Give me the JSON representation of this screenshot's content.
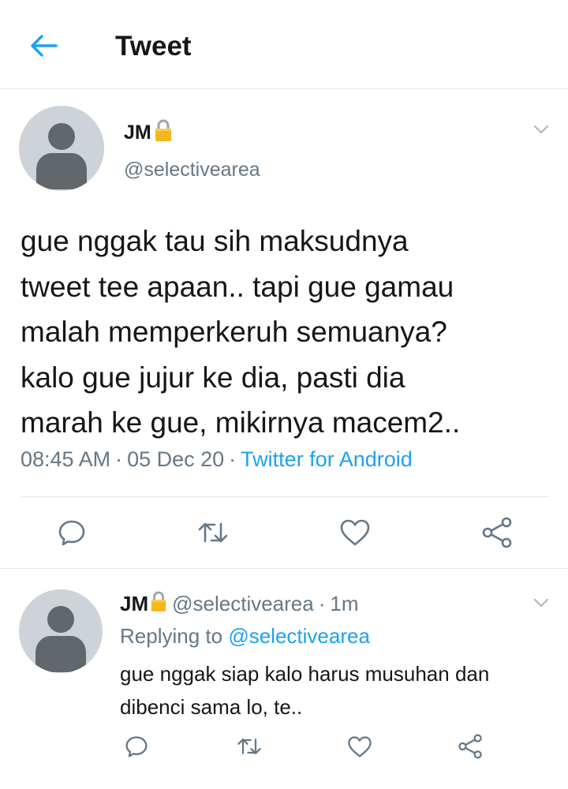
{
  "header": {
    "back_icon": "arrow-left-icon",
    "title": "Tweet"
  },
  "colors": {
    "accent": "#1da1f2",
    "secondary_text": "#657786",
    "primary_text": "#14171a",
    "divider": "#e1e8ed"
  },
  "tweet": {
    "name": "JM",
    "lock_icon": "lock-icon",
    "handle": "@selectivearea",
    "text_lines": [
      "gue nggak tau sih maksudnya",
      "tweet tee apaan.. tapi gue gamau",
      "malah memperkeruh semuanya?",
      "kalo gue jujur ke dia, pasti dia",
      "marah ke gue, mikirnya macem2.."
    ],
    "time": "08:45 AM",
    "separator": "·",
    "date": "05 Dec 20",
    "source": "Twitter for Android",
    "actions": [
      "reply-icon",
      "retweet-icon",
      "like-icon",
      "share-icon"
    ]
  },
  "reply": {
    "name": "JM",
    "handle": "@selectivearea",
    "separator": "·",
    "time": "1m",
    "replying_prefix": "Replying to",
    "replying_to": "@selectivearea",
    "text_lines": [
      "gue nggak siap kalo harus musuhan dan",
      "dibenci sama lo, te.."
    ],
    "actions": [
      "reply-icon",
      "retweet-icon",
      "like-icon",
      "share-icon"
    ]
  }
}
